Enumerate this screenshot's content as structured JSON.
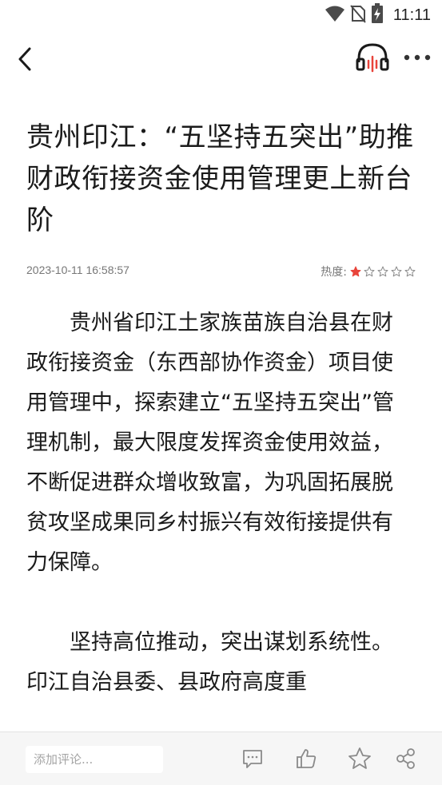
{
  "status_bar": {
    "time": "11:11",
    "icons": [
      "wifi-icon",
      "no-sim-icon",
      "battery-charging-icon"
    ]
  },
  "top_bar": {
    "back_icon": "chevron-left-icon",
    "listen_icon": "headphones-icon",
    "more_icon": "more-dots-icon"
  },
  "article": {
    "title": "贵州印江：“五坚持五突出”助推财政衔接资金使用管理更上新台阶",
    "date": "2023-10-11 16:58:57",
    "heat_label": "热度:",
    "heat_rating": 1,
    "heat_max": 5,
    "accent_color": "#e8443b",
    "paragraphs": [
      "贵州省印江土家族苗族自治县在财政衔接资金（东西部协作资金）项目使用管理中，探索建立“五坚持五突出”管理机制，最大限度发挥资金使用效益，不断促进群众增收致富，为巩固拓展脱贫攻坚成果同乡村振兴有效衔接提供有力保障。",
      "坚持高位推动，突出谋划系统性。印江自治县委、县政府高度重"
    ]
  },
  "bottom_bar": {
    "comment_placeholder": "添加评论...",
    "icons": [
      "comment-icon",
      "like-icon",
      "favorite-star-icon",
      "share-icon"
    ]
  }
}
